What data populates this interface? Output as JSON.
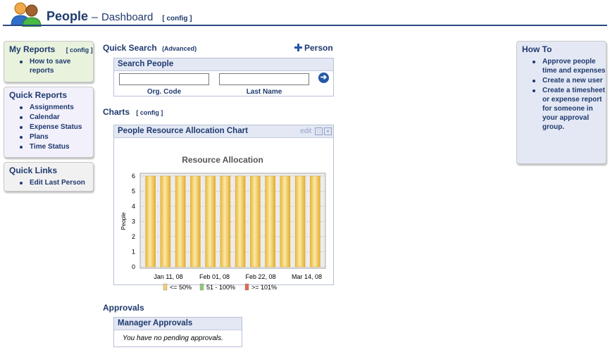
{
  "header": {
    "title": "People",
    "separator": "–",
    "subtitle": "Dashboard",
    "config_link": "[ config ]"
  },
  "my_reports": {
    "title": "My Reports",
    "config_link": "[ config ]",
    "items": [
      "How to save reports"
    ]
  },
  "quick_reports": {
    "title": "Quick Reports",
    "items": [
      "Assignments",
      "Calendar",
      "Expense Status",
      "Plans",
      "Time Status"
    ]
  },
  "quick_links": {
    "title": "Quick Links",
    "items": [
      "Edit Last Person"
    ]
  },
  "how_to": {
    "title": "How To",
    "items": [
      "Approve people time and expenses",
      "Create a new user",
      "Create a timesheet or expense report for someone in your approval group."
    ]
  },
  "quick_search": {
    "title": "Quick Search",
    "advanced_link": "(Advanced)",
    "add_person": "Person",
    "panel_title": "Search People",
    "field1_label": "Org. Code",
    "field2_label": "Last Name",
    "field1_value": "",
    "field2_value": ""
  },
  "charts_section": {
    "title": "Charts",
    "config_link": "[ config ]",
    "panel_title": "People Resource Allocation Chart",
    "edit_link": "edit"
  },
  "approvals": {
    "title": "Approvals",
    "panel_title": "Manager Approvals",
    "message": "You have no pending approvals."
  },
  "colors": {
    "brand_blue": "#1f3a6e",
    "bar_gold": "#f3cf6e",
    "legend_green": "#8fc97a",
    "legend_red": "#e06a4f"
  },
  "chart_data": {
    "type": "bar",
    "title": "Resource Allocation",
    "xlabel": "",
    "ylabel": "People",
    "ylim": [
      0,
      6
    ],
    "yticks": [
      0,
      1,
      2,
      3,
      4,
      5,
      6
    ],
    "x_tick_labels": [
      "Jan 11, 08",
      "Feb 01, 08",
      "Feb 22, 08",
      "Mar 14, 08"
    ],
    "series": [
      {
        "name": "<= 50%",
        "color": "#f3cf6e",
        "values": [
          6,
          6,
          6,
          6,
          6,
          6,
          6,
          6,
          6,
          6,
          6,
          6
        ]
      },
      {
        "name": "51 - 100%",
        "color": "#8fc97a",
        "values": [
          0,
          0,
          0,
          0,
          0,
          0,
          0,
          0,
          0,
          0,
          0,
          0
        ]
      },
      {
        "name": ">= 101%",
        "color": "#e06a4f",
        "values": [
          0,
          0,
          0,
          0,
          0,
          0,
          0,
          0,
          0,
          0,
          0,
          0
        ]
      }
    ],
    "grid": true,
    "legend": "bottom"
  }
}
